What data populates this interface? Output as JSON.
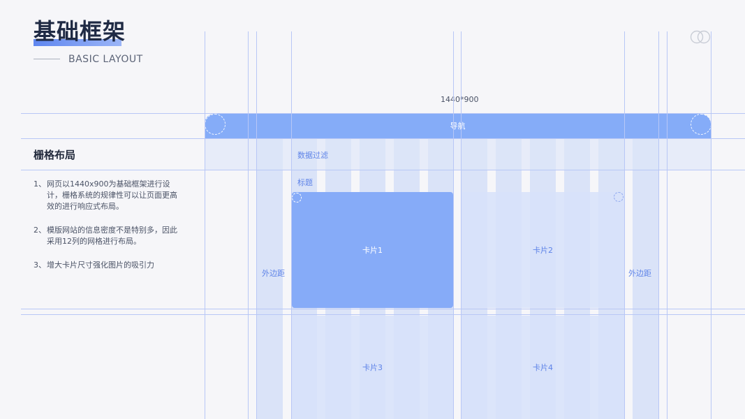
{
  "header": {
    "title": "基础框架",
    "subtitle": "BASIC LAYOUT"
  },
  "icons": {
    "logo": "overlapping-circles-icon"
  },
  "sidebar": {
    "section_title": "栅格布局",
    "notes": [
      {
        "num": "1、",
        "text": "网页以1440x900为基础框架进行设计，栅格系统的规律性可以让页面更高效的进行响应式布局。"
      },
      {
        "num": "2、",
        "text": "模版网站的信息密度不是特别多，因此采用12列的网格进行布局。"
      },
      {
        "num": "3、",
        "text": "增大卡片尺寸强化图片的吸引力"
      }
    ]
  },
  "wireframe": {
    "dimension": "1440*900",
    "nav_label": "导航",
    "filter_label": "数据过滤",
    "heading_label": "标题",
    "margin_left": "外边距",
    "margin_right": "外边距",
    "cards": [
      "卡片1",
      "卡片2",
      "卡片3",
      "卡片4"
    ]
  },
  "colors": {
    "accent": "#85acf8",
    "grid_line": "#b8c7f6",
    "label": "#5f84e8",
    "background": "#f6f6f9"
  }
}
